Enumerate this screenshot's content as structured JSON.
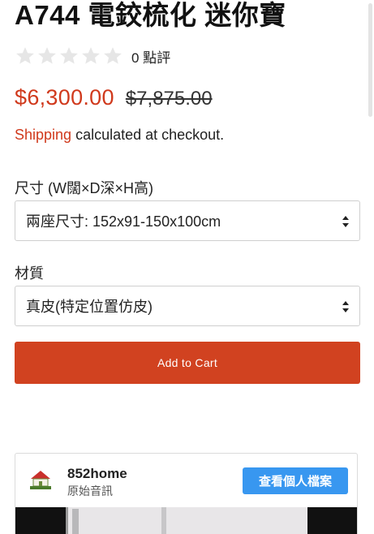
{
  "product": {
    "title": "A744 電鉸梳化 迷你寶",
    "review_count": "0 點評",
    "rating": 0,
    "rating_max": 5,
    "price_sale": "$6,300.00",
    "price_compare": "$7,875.00",
    "shipping_link": "Shipping",
    "shipping_text": " calculated at checkout."
  },
  "options": [
    {
      "label": "尺寸 (W闊×D深×H高)",
      "selected": "兩座尺寸: 152x91-150x100cm"
    },
    {
      "label": "材質",
      "selected": "真皮(特定位置仿皮)"
    }
  ],
  "add_to_cart_label": "Add to Cart",
  "instagram_card": {
    "account_name": "852home",
    "subtitle": "原始音訊",
    "profile_button": "查看個人檔案"
  },
  "colors": {
    "accent": "#d0391c",
    "button": "#d14220",
    "instagram_blue": "#3897f0",
    "star_empty": "#e6e6e6"
  },
  "icons": [
    "star-icon",
    "select-arrows-icon",
    "store-logo-icon"
  ]
}
